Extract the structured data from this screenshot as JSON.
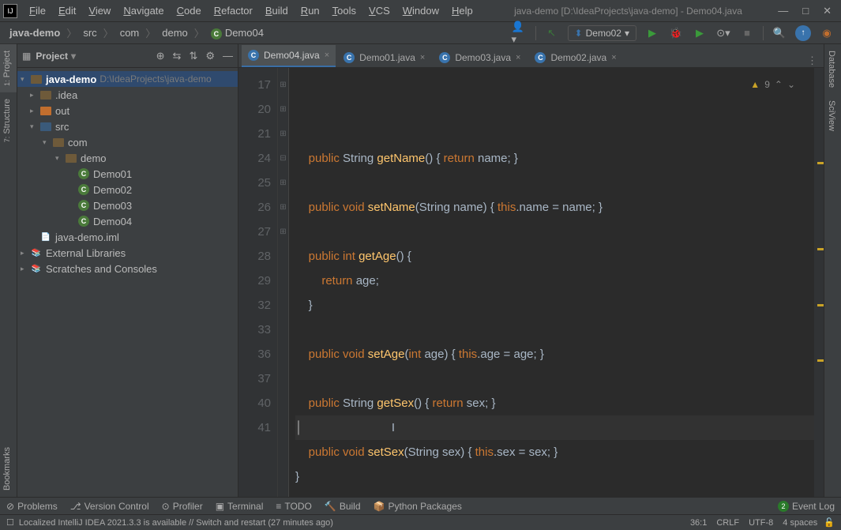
{
  "title": "java-demo [D:\\IdeaProjects\\java-demo] - Demo04.java",
  "menu": [
    "File",
    "Edit",
    "View",
    "Navigate",
    "Code",
    "Refactor",
    "Build",
    "Run",
    "Tools",
    "VCS",
    "Window",
    "Help"
  ],
  "breadcrumb": [
    "java-demo",
    "src",
    "com",
    "demo",
    "Demo04"
  ],
  "run_config": "Demo02",
  "sidebar_title": "Project",
  "tree": {
    "root": "java-demo",
    "root_path": "D:\\IdeaProjects\\java-demo",
    "items": [
      {
        "name": ".idea",
        "type": "folder",
        "indent": 1,
        "arrow": ">"
      },
      {
        "name": "out",
        "type": "folder-orange",
        "indent": 1,
        "arrow": ">"
      },
      {
        "name": "src",
        "type": "folder-blue",
        "indent": 1,
        "arrow": "v"
      },
      {
        "name": "com",
        "type": "folder",
        "indent": 2,
        "arrow": "v"
      },
      {
        "name": "demo",
        "type": "folder",
        "indent": 3,
        "arrow": "v"
      },
      {
        "name": "Demo01",
        "type": "class",
        "indent": 4
      },
      {
        "name": "Demo02",
        "type": "class",
        "indent": 4
      },
      {
        "name": "Demo03",
        "type": "class",
        "indent": 4
      },
      {
        "name": "Demo04",
        "type": "class",
        "indent": 4
      },
      {
        "name": "java-demo.iml",
        "type": "file",
        "indent": 1
      }
    ],
    "external": "External Libraries",
    "scratches": "Scratches and Consoles"
  },
  "tabs": [
    {
      "label": "Demo04.java",
      "active": true
    },
    {
      "label": "Demo01.java",
      "active": false
    },
    {
      "label": "Demo03.java",
      "active": false
    },
    {
      "label": "Demo02.java",
      "active": false
    }
  ],
  "warning_count": "9",
  "gutter": [
    "17",
    "20",
    "21",
    "24",
    "25",
    "26",
    "27",
    "28",
    "29",
    "32",
    "33",
    "36",
    "37",
    "40",
    "41"
  ],
  "code_lines": [
    {
      "n": "17",
      "tokens": [
        {
          "t": "    ",
          "c": ""
        },
        {
          "t": "public",
          "c": "kw"
        },
        {
          "t": " String ",
          "c": ""
        },
        {
          "t": "getName",
          "c": "func"
        },
        {
          "t": "() { ",
          "c": ""
        },
        {
          "t": "return",
          "c": "kw"
        },
        {
          "t": " name; ",
          "c": ""
        },
        {
          "t": "}",
          "c": ""
        }
      ]
    },
    {
      "n": "20",
      "tokens": []
    },
    {
      "n": "21",
      "tokens": [
        {
          "t": "    ",
          "c": ""
        },
        {
          "t": "public",
          "c": "kw"
        },
        {
          "t": " ",
          "c": ""
        },
        {
          "t": "void",
          "c": "kw"
        },
        {
          "t": " ",
          "c": ""
        },
        {
          "t": "setName",
          "c": "func"
        },
        {
          "t": "(String name) { ",
          "c": ""
        },
        {
          "t": "this",
          "c": "kw"
        },
        {
          "t": ".name = name; ",
          "c": ""
        },
        {
          "t": "}",
          "c": ""
        }
      ]
    },
    {
      "n": "24",
      "tokens": []
    },
    {
      "n": "25",
      "tokens": [
        {
          "t": "    ",
          "c": ""
        },
        {
          "t": "public",
          "c": "kw"
        },
        {
          "t": " ",
          "c": ""
        },
        {
          "t": "int",
          "c": "kw"
        },
        {
          "t": " ",
          "c": ""
        },
        {
          "t": "getAge",
          "c": "func"
        },
        {
          "t": "() {",
          "c": ""
        }
      ]
    },
    {
      "n": "26",
      "tokens": [
        {
          "t": "        ",
          "c": ""
        },
        {
          "t": "return",
          "c": "kw"
        },
        {
          "t": " age;",
          "c": ""
        }
      ]
    },
    {
      "n": "27",
      "tokens": [
        {
          "t": "    }",
          "c": ""
        }
      ]
    },
    {
      "n": "28",
      "tokens": []
    },
    {
      "n": "29",
      "tokens": [
        {
          "t": "    ",
          "c": ""
        },
        {
          "t": "public",
          "c": "kw"
        },
        {
          "t": " ",
          "c": ""
        },
        {
          "t": "void",
          "c": "kw"
        },
        {
          "t": " ",
          "c": ""
        },
        {
          "t": "setAge",
          "c": "func"
        },
        {
          "t": "(",
          "c": ""
        },
        {
          "t": "int",
          "c": "kw"
        },
        {
          "t": " age) { ",
          "c": ""
        },
        {
          "t": "this",
          "c": "kw"
        },
        {
          "t": ".age = age; ",
          "c": ""
        },
        {
          "t": "}",
          "c": ""
        }
      ]
    },
    {
      "n": "32",
      "tokens": []
    },
    {
      "n": "33",
      "tokens": [
        {
          "t": "    ",
          "c": ""
        },
        {
          "t": "public",
          "c": "kw"
        },
        {
          "t": " String ",
          "c": ""
        },
        {
          "t": "getSex",
          "c": "func"
        },
        {
          "t": "() { ",
          "c": ""
        },
        {
          "t": "return",
          "c": "kw"
        },
        {
          "t": " sex; ",
          "c": ""
        },
        {
          "t": "}",
          "c": ""
        }
      ]
    },
    {
      "n": "36",
      "tokens": [],
      "current": true
    },
    {
      "n": "37",
      "tokens": [
        {
          "t": "    ",
          "c": ""
        },
        {
          "t": "public",
          "c": "kw"
        },
        {
          "t": " ",
          "c": ""
        },
        {
          "t": "void",
          "c": "kw"
        },
        {
          "t": " ",
          "c": ""
        },
        {
          "t": "setSex",
          "c": "func"
        },
        {
          "t": "(String sex) { ",
          "c": ""
        },
        {
          "t": "this",
          "c": "kw"
        },
        {
          "t": ".sex = sex; ",
          "c": ""
        },
        {
          "t": "}",
          "c": ""
        }
      ]
    },
    {
      "n": "40",
      "tokens": [
        {
          "t": "}",
          "c": ""
        }
      ]
    },
    {
      "n": "41",
      "tokens": []
    }
  ],
  "left_rail": [
    {
      "label": "Project",
      "num": "1:",
      "active": true
    },
    {
      "label": "Structure",
      "num": "7:",
      "active": false
    }
  ],
  "left_rail_bottom": "Bookmarks",
  "right_rail": [
    "Database",
    "SciView"
  ],
  "bottom_tools": [
    "Problems",
    "Version Control",
    "Profiler",
    "Terminal",
    "TODO",
    "Build",
    "Python Packages"
  ],
  "event_log": "Event Log",
  "event_badge": "2",
  "status_msg": "Localized IntelliJ IDEA 2021.3.3 is available // Switch and restart (27 minutes ago)",
  "status_right": [
    "36:1",
    "CRLF",
    "UTF-8",
    "4 spaces"
  ]
}
